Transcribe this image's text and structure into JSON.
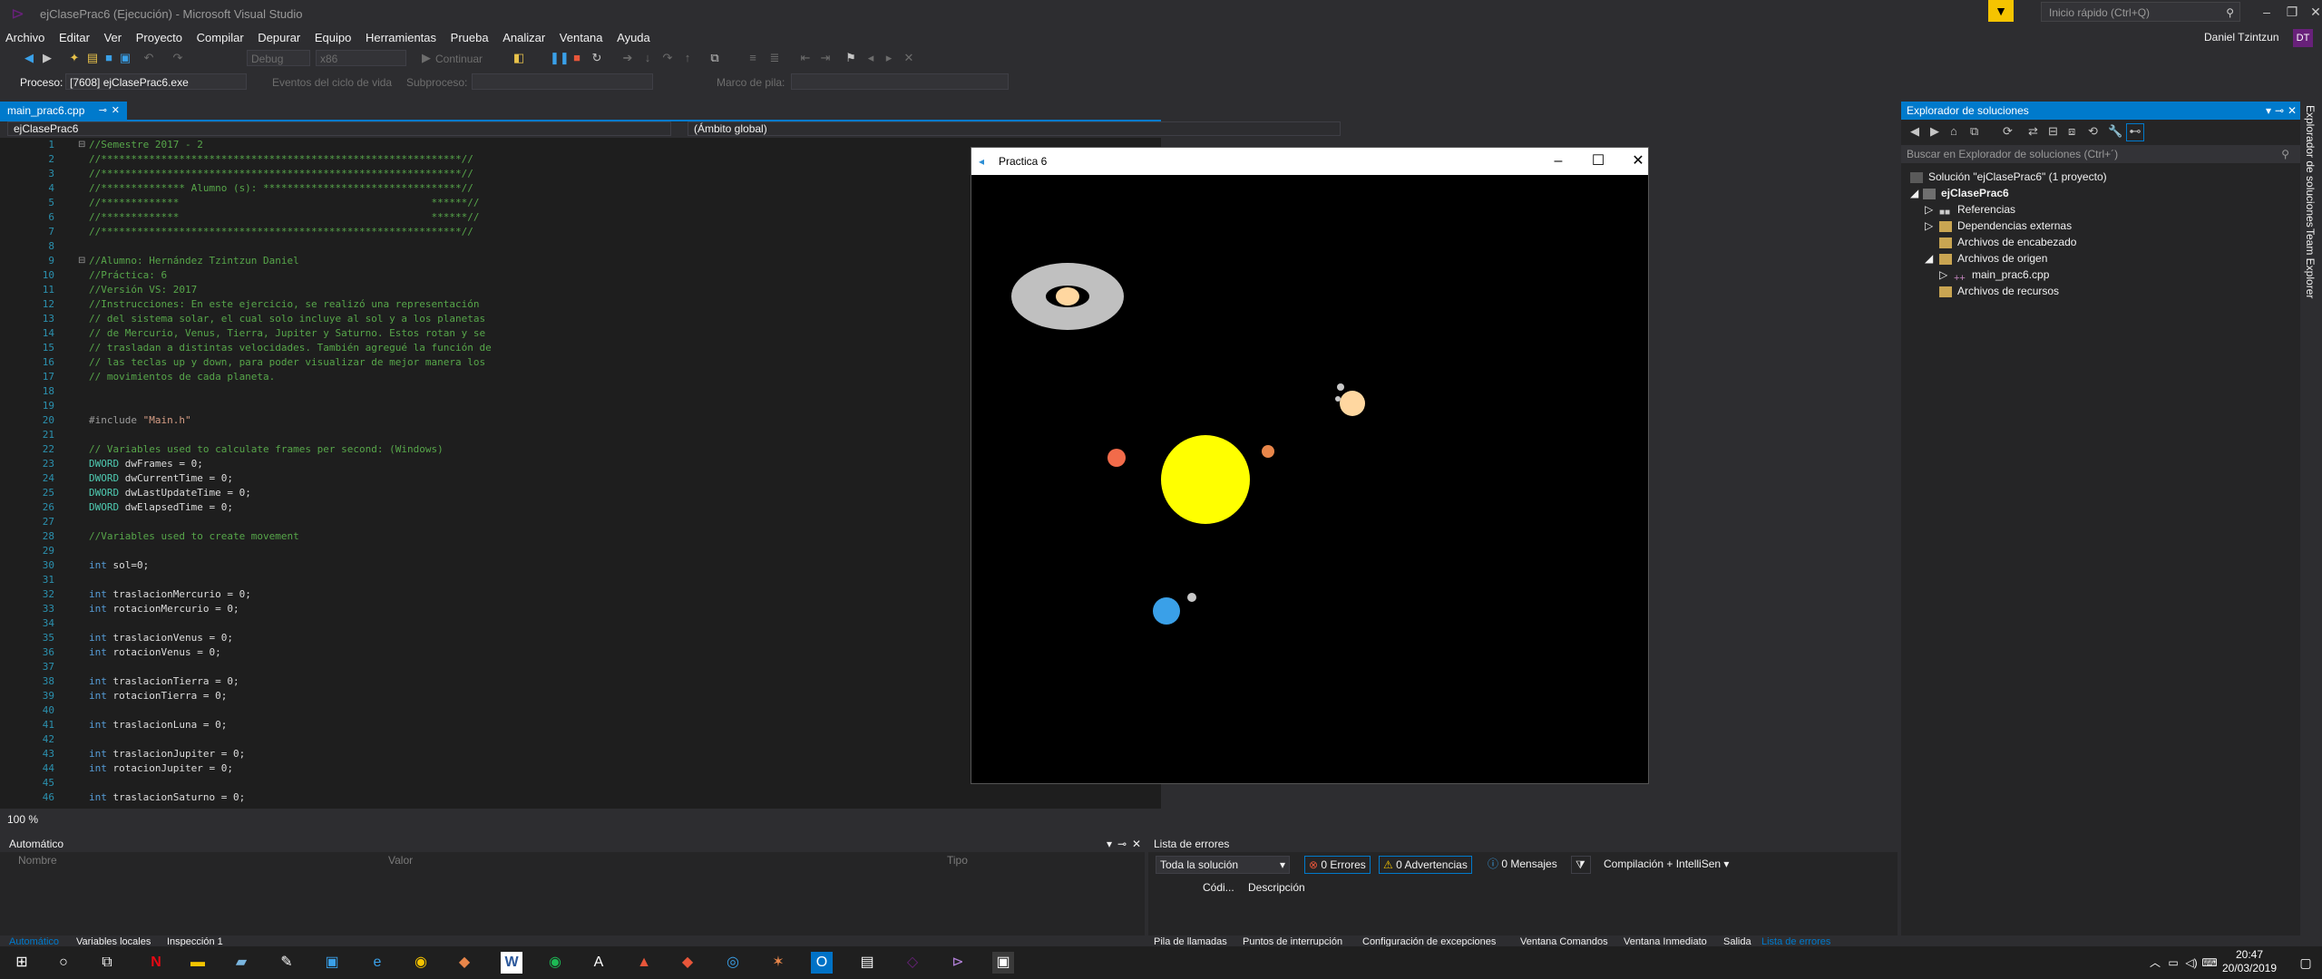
{
  "window": {
    "title": "ejClasePrac6 (Ejecución) - Microsoft Visual Studio",
    "quick_launch_placeholder": "Inicio rápido (Ctrl+Q)",
    "user_name": "Daniel Tzintzun",
    "user_initials": "DT"
  },
  "menu": [
    "Archivo",
    "Editar",
    "Ver",
    "Proyecto",
    "Compilar",
    "Depurar",
    "Equipo",
    "Herramientas",
    "Prueba",
    "Analizar",
    "Ventana",
    "Ayuda"
  ],
  "toolbar": {
    "config": "Debug",
    "platform": "x86",
    "continue_label": "Continuar"
  },
  "process_bar": {
    "process_label": "Proceso:",
    "process_value": "[7608] ejClasePrac6.exe",
    "lifecycle_label": "Eventos del ciclo de vida",
    "subprocess_label": "Subproceso:",
    "stack_label": "Marco de pila:"
  },
  "editor": {
    "tab_label": "main_prac6.cpp",
    "nav_file": "ejClasePrac6",
    "nav_scope": "(Ámbito global)",
    "zoom": "100 %",
    "lines": [
      {
        "n": "1",
        "cls": "cm",
        "text": "//Semestre 2017 - 2"
      },
      {
        "n": "2",
        "cls": "cm",
        "text": "//************************************************************//"
      },
      {
        "n": "3",
        "cls": "cm",
        "text": "//************************************************************//"
      },
      {
        "n": "4",
        "cls": "cm",
        "text": "//************** Alumno (s): *********************************//"
      },
      {
        "n": "5",
        "cls": "cm",
        "text": "//*************                                          ******//"
      },
      {
        "n": "6",
        "cls": "cm",
        "text": "//*************                                          ******//"
      },
      {
        "n": "7",
        "cls": "cm",
        "text": "//************************************************************//"
      },
      {
        "n": "8",
        "cls": "cm",
        "text": ""
      },
      {
        "n": "9",
        "cls": "cm",
        "text": "//Alumno: Hernández Tzintzun Daniel"
      },
      {
        "n": "10",
        "cls": "cm",
        "text": "//Práctica: 6"
      },
      {
        "n": "11",
        "cls": "cm",
        "text": "//Versión VS: 2017"
      },
      {
        "n": "12",
        "cls": "cm",
        "text": "//Instrucciones: En este ejercicio, se realizó una representación"
      },
      {
        "n": "13",
        "cls": "cm",
        "text": "// del sistema solar, el cual solo incluye al sol y a los planetas"
      },
      {
        "n": "14",
        "cls": "cm",
        "text": "// de Mercurio, Venus, Tierra, Jupiter y Saturno. Estos rotan y se"
      },
      {
        "n": "15",
        "cls": "cm",
        "text": "// trasladan a distintas velocidades. También agregué la función de"
      },
      {
        "n": "16",
        "cls": "cm",
        "text": "// las teclas up y down, para poder visualizar de mejor manera los"
      },
      {
        "n": "17",
        "cls": "cm",
        "text": "// movimientos de cada planeta."
      },
      {
        "n": "18",
        "cls": "pl",
        "text": ""
      },
      {
        "n": "19",
        "cls": "pl",
        "text": ""
      },
      {
        "n": "20",
        "cls": "inc",
        "text": "#include \"Main.h\""
      },
      {
        "n": "21",
        "cls": "pl",
        "text": ""
      },
      {
        "n": "22",
        "cls": "cm",
        "text": "// Variables used to calculate frames per second: (Windows)"
      },
      {
        "n": "23",
        "cls": "dw",
        "text": "DWORD dwFrames = 0;"
      },
      {
        "n": "24",
        "cls": "dw",
        "text": "DWORD dwCurrentTime = 0;"
      },
      {
        "n": "25",
        "cls": "dw",
        "text": "DWORD dwLastUpdateTime = 0;"
      },
      {
        "n": "26",
        "cls": "dw",
        "text": "DWORD dwElapsedTime = 0;"
      },
      {
        "n": "27",
        "cls": "pl",
        "text": ""
      },
      {
        "n": "28",
        "cls": "cm",
        "text": "//Variables used to create movement"
      },
      {
        "n": "29",
        "cls": "pl",
        "text": ""
      },
      {
        "n": "30",
        "cls": "int",
        "text": "int sol=0;"
      },
      {
        "n": "31",
        "cls": "pl",
        "text": ""
      },
      {
        "n": "32",
        "cls": "int",
        "text": "int traslacionMercurio = 0;"
      },
      {
        "n": "33",
        "cls": "int",
        "text": "int rotacionMercurio = 0;"
      },
      {
        "n": "34",
        "cls": "pl",
        "text": ""
      },
      {
        "n": "35",
        "cls": "int",
        "text": "int traslacionVenus = 0;"
      },
      {
        "n": "36",
        "cls": "int",
        "text": "int rotacionVenus = 0;"
      },
      {
        "n": "37",
        "cls": "pl",
        "text": ""
      },
      {
        "n": "38",
        "cls": "int",
        "text": "int traslacionTierra = 0;"
      },
      {
        "n": "39",
        "cls": "int",
        "text": "int rotacionTierra = 0;"
      },
      {
        "n": "40",
        "cls": "pl",
        "text": ""
      },
      {
        "n": "41",
        "cls": "int",
        "text": "int traslacionLuna = 0;"
      },
      {
        "n": "42",
        "cls": "pl",
        "text": ""
      },
      {
        "n": "43",
        "cls": "int",
        "text": "int traslacionJupiter = 0;"
      },
      {
        "n": "44",
        "cls": "int",
        "text": "int rotacionJupiter = 0;"
      },
      {
        "n": "45",
        "cls": "pl",
        "text": ""
      },
      {
        "n": "46",
        "cls": "int",
        "text": "int traslacionSaturno = 0;"
      }
    ]
  },
  "practica": {
    "title": "Practica 6",
    "colors": {
      "sun": "#ffff00",
      "mercury": "#e8864a",
      "venus": "#f26b4a",
      "earth": "#3aa0e8",
      "moon": "#c8c8c8",
      "jupiter": "#ffd7a0",
      "saturn_ring": "#c0c0c0"
    }
  },
  "solution_explorer": {
    "title": "Explorador de soluciones",
    "search_placeholder": "Buscar en Explorador de soluciones (Ctrl+´)",
    "solution": "Solución \"ejClasePrac6\" (1 proyecto)",
    "project": "ejClasePrac6",
    "items": [
      "Referencias",
      "Dependencias externas",
      "Archivos de encabezado",
      "Archivos de origen",
      "main_prac6.cpp",
      "Archivos de recursos"
    ],
    "side_tabs": [
      "Explorador de soluciones",
      "Team Explorer"
    ]
  },
  "auto_panel": {
    "title": "Automático",
    "columns": [
      "Nombre",
      "Valor",
      "Tipo"
    ],
    "tabs": [
      "Automático",
      "Variables locales",
      "Inspección 1"
    ]
  },
  "error_panel": {
    "title": "Lista de errores",
    "scope": "Toda la solución",
    "errors": "0 Errores",
    "warnings": "0 Advertencias",
    "messages": "0 Mensajes",
    "build": "Compilación + IntelliSen",
    "columns": [
      "Códi...",
      "Descripción"
    ],
    "tabs": [
      "Pila de llamadas",
      "Puntos de interrupción",
      "Configuración de excepciones",
      "Ventana Comandos",
      "Ventana Inmediato",
      "Salida",
      "Lista de errores"
    ]
  },
  "taskbar": {
    "time": "20:47",
    "date": "20/03/2019"
  }
}
